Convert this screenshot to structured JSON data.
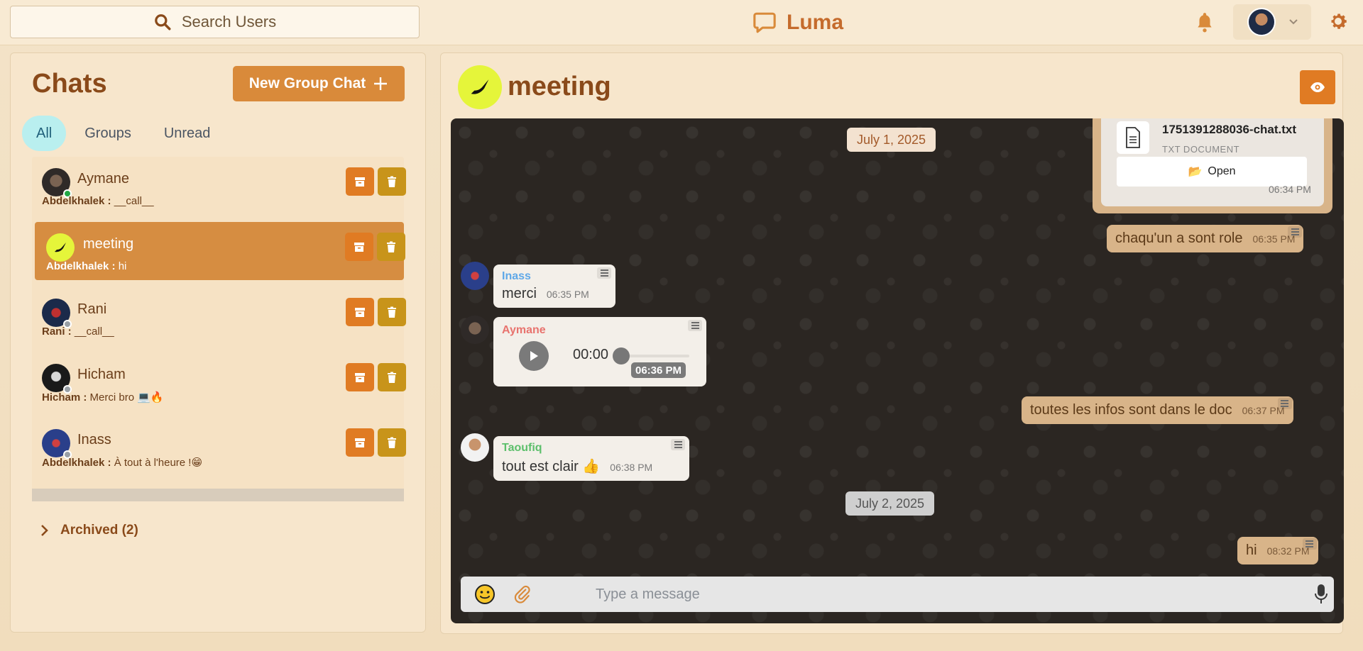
{
  "topbar": {
    "search_label": "Search Users",
    "brand": "Luma"
  },
  "sidebar": {
    "title": "Chats",
    "new_group_label": "New Group Chat",
    "tabs": [
      "All",
      "Groups",
      "Unread"
    ],
    "active_tab": "All",
    "chats": [
      {
        "name": "Aymane",
        "preview_sender": "Abdelkhalek :",
        "preview_text": "__call__",
        "status": "online",
        "status_color": "#22a845"
      },
      {
        "name": "meeting",
        "preview_sender": "Abdelkhalek :",
        "preview_text": "hi",
        "status": "",
        "active": true
      },
      {
        "name": "Rani",
        "preview_sender": "Rani :",
        "preview_text": "__call__",
        "status": "offline",
        "status_color": "#9aa0a6"
      },
      {
        "name": "Hicham",
        "preview_sender": "Hicham :",
        "preview_text": "Merci bro 💻🔥",
        "status": "offline",
        "status_color": "#9aa0a6"
      },
      {
        "name": "Inass",
        "preview_sender": "Abdelkhalek :",
        "preview_text": "À tout à l'heure !😁",
        "status": "offline",
        "status_color": "#9aa0a6"
      }
    ],
    "archived_label": "Archived (2)"
  },
  "main": {
    "title": "meeting",
    "dates": [
      "July 1, 2025",
      "July 2, 2025"
    ],
    "document": {
      "file_name": "1751391288036-chat.txt",
      "file_type": "TXT DOCUMENT",
      "open_label": "Open",
      "time": "06:34 PM"
    },
    "messages": [
      {
        "direction": "out",
        "text": "chaqu'un a sont role",
        "time": "06:35 PM"
      },
      {
        "direction": "in",
        "sender": "Inass",
        "sender_color": "#5fa8e8",
        "text": "merci",
        "time": "06:35 PM"
      },
      {
        "direction": "out",
        "text": "toutes les infos sont dans le doc",
        "time": "06:37 PM"
      },
      {
        "direction": "in",
        "sender": "Taoufiq",
        "sender_color": "#5cbf6b",
        "text": "tout est clair 👍",
        "time": "06:38 PM"
      },
      {
        "direction": "out",
        "text": "hi",
        "time": "08:32 PM"
      }
    ],
    "voice": {
      "sender": "Aymane",
      "sender_color": "#e8736e",
      "elapsed": "00:00",
      "time": "06:36 PM",
      "progress": 0
    },
    "composer_placeholder": "Type a message"
  },
  "colors": {
    "accent": "#d98a3a",
    "archive": "#e07b23",
    "delete": "#c8941a",
    "brand_text": "#c56b2c"
  },
  "icons": [
    "search-icon",
    "chat-bubble-icon",
    "bell-icon",
    "chevron-down-icon",
    "gear-icon",
    "plus-icon",
    "archive-icon",
    "trash-icon",
    "chevron-right-icon",
    "eye-icon",
    "document-icon",
    "folder-icon",
    "play-icon",
    "emoji-icon",
    "paperclip-icon",
    "microphone-icon",
    "menu-icon"
  ]
}
